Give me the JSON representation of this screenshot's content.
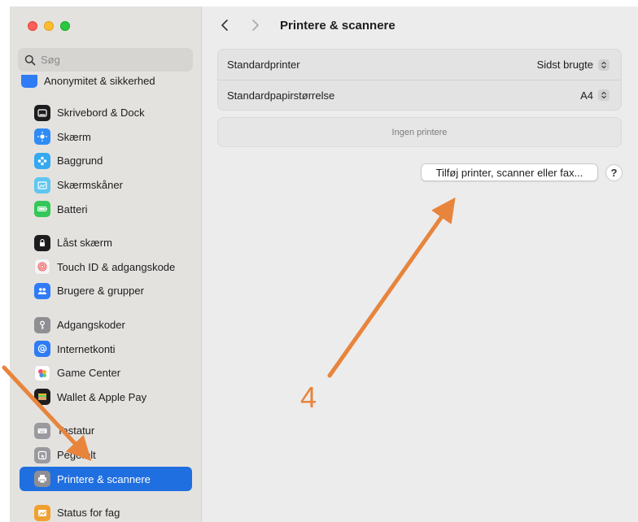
{
  "window": {
    "title": "Printere & scannere"
  },
  "search": {
    "placeholder": "Søg"
  },
  "sidebar": {
    "cutoff_label": "Anonymitet & sikkerhed",
    "items": [
      {
        "label": "Skrivebord & Dock",
        "icon": "dock-icon",
        "color": "#1d1d1f"
      },
      {
        "label": "Skærm",
        "icon": "display-icon",
        "color": "#2f8cf6"
      },
      {
        "label": "Baggrund",
        "icon": "wallpaper-icon",
        "color": "#34a9f0"
      },
      {
        "label": "Skærmskåner",
        "icon": "screensaver-icon",
        "color": "#5fc6f0"
      },
      {
        "label": "Batteri",
        "icon": "battery-icon",
        "color": "#34c759"
      },
      {
        "label": "Låst skærm",
        "icon": "lock-screen-icon",
        "color": "#1d1d1f"
      },
      {
        "label": "Touch ID & adgangskode",
        "icon": "fingerprint-icon",
        "color": "#f5f5f5"
      },
      {
        "label": "Brugere & grupper",
        "icon": "users-icon",
        "color": "#2f7cf6"
      },
      {
        "label": "Adgangskoder",
        "icon": "key-icon",
        "color": "#8e8e93"
      },
      {
        "label": "Internetkonti",
        "icon": "at-icon",
        "color": "#2f7cf6"
      },
      {
        "label": "Game Center",
        "icon": "game-center-icon",
        "color": "#ffffff"
      },
      {
        "label": "Wallet & Apple Pay",
        "icon": "wallet-icon",
        "color": "#1d1d1f"
      },
      {
        "label": "Tastatur",
        "icon": "keyboard-icon",
        "color": "#9a9a9e"
      },
      {
        "label": "Pegefelt",
        "icon": "trackpad-icon",
        "color": "#9a9a9e"
      },
      {
        "label": "Printere & scannere",
        "icon": "printer-icon",
        "color": "#8e8e93",
        "selected": true
      },
      {
        "label": "Status for fag",
        "icon": "status-icon",
        "color": "#f0a030"
      }
    ]
  },
  "settings": {
    "default_printer_label": "Standardprinter",
    "default_printer_value": "Sidst brugte",
    "paper_size_label": "Standardpapirstørrelse",
    "paper_size_value": "A4"
  },
  "empty_state": "Ingen printere",
  "add_button": "Tilføj printer, scanner eller fax...",
  "help_button": "?",
  "annotation": {
    "number": "4",
    "color": "#e8843c"
  }
}
